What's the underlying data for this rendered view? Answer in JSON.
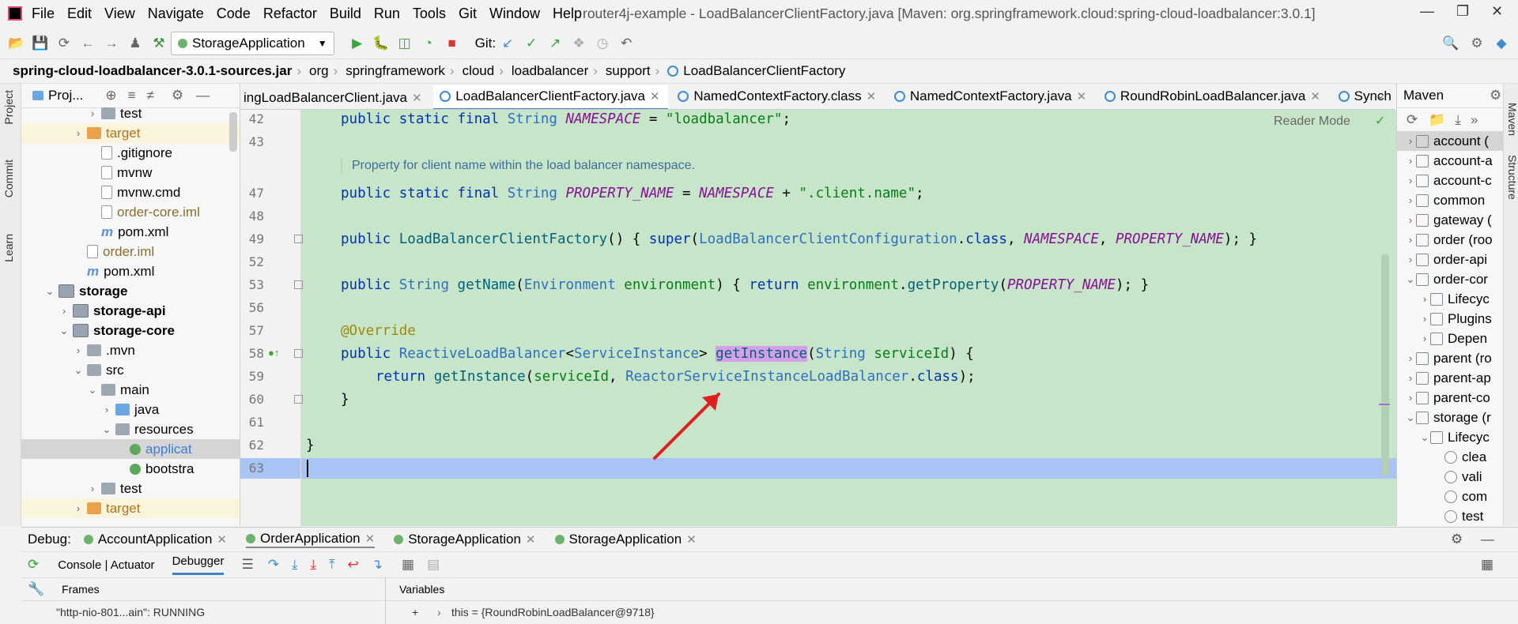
{
  "menu": [
    "File",
    "Edit",
    "View",
    "Navigate",
    "Code",
    "Refactor",
    "Build",
    "Run",
    "Tools",
    "Git",
    "Window",
    "Help"
  ],
  "window_title": "router4j-example - LoadBalancerClientFactory.java [Maven: org.springframework.cloud:spring-cloud-loadbalancer:3.0.1]",
  "toolbar": {
    "run_config": "StorageApplication",
    "git_label": "Git:"
  },
  "breadcrumb": [
    "spring-cloud-loadbalancer-3.0.1-sources.jar",
    "org",
    "springframework",
    "cloud",
    "loadbalancer",
    "support",
    "LoadBalancerClientFactory"
  ],
  "left_strip": [
    "Project",
    "Commit",
    "Learn"
  ],
  "project": {
    "title": "Proj...",
    "rows": [
      {
        "label": "test",
        "type": "folder"
      },
      {
        "label": "target",
        "type": "target"
      },
      {
        "label": ".gitignore",
        "type": "file"
      },
      {
        "label": "mvnw",
        "type": "file"
      },
      {
        "label": "mvnw.cmd",
        "type": "file"
      },
      {
        "label": "order-core.iml",
        "type": "file"
      },
      {
        "label": "pom.xml",
        "type": "maven"
      },
      {
        "label": "order.iml",
        "type": "file"
      },
      {
        "label": "pom.xml",
        "type": "maven"
      },
      {
        "label": "storage",
        "type": "module"
      },
      {
        "label": "storage-api",
        "type": "module"
      },
      {
        "label": "storage-core",
        "type": "module"
      },
      {
        "label": ".mvn",
        "type": "folder"
      },
      {
        "label": "src",
        "type": "folder"
      },
      {
        "label": "main",
        "type": "folder"
      },
      {
        "label": "java",
        "type": "source"
      },
      {
        "label": "resources",
        "type": "folder"
      },
      {
        "label": "applicat",
        "type": "spring"
      },
      {
        "label": "bootstra",
        "type": "spring"
      },
      {
        "label": "test",
        "type": "folder"
      },
      {
        "label": "target",
        "type": "target"
      }
    ]
  },
  "tabs": [
    {
      "label": "ingLoadBalancerClient.java",
      "active": false
    },
    {
      "label": "LoadBalancerClientFactory.java",
      "active": true
    },
    {
      "label": "NamedContextFactory.class",
      "active": false
    },
    {
      "label": "NamedContextFactory.java",
      "active": false
    },
    {
      "label": "RoundRobinLoadBalancer.java",
      "active": false
    },
    {
      "label": "Synch",
      "active": false
    }
  ],
  "editor": {
    "reader_mode": "Reader Mode",
    "doc_comment": "Property for client name within the load balancer namespace.",
    "line_numbers": [
      "42",
      "43",
      "47",
      "48",
      "49",
      "52",
      "53",
      "56",
      "57",
      "58",
      "59",
      "60",
      "61",
      "62",
      "63"
    ],
    "lines": {
      "l42": "public static final String NAMESPACE = \"loadbalancer\";",
      "l47": "public static final String PROPERTY_NAME = NAMESPACE + \".client.name\";",
      "l49": "public LoadBalancerClientFactory() { super(LoadBalancerClientConfiguration.class, NAMESPACE, PROPERTY_NAME); }",
      "l53": "public String getName(Environment environment) { return environment.getProperty(PROPERTY_NAME); }",
      "l57": "@Override",
      "l58": "public ReactiveLoadBalancer<ServiceInstance> getInstance(String serviceId) {",
      "l59": "return getInstance(serviceId, ReactorServiceInstanceLoadBalancer.class);",
      "l60": "}",
      "l62": "}"
    }
  },
  "maven": {
    "title": "Maven",
    "rows": [
      "account (",
      "account-a",
      "account-c",
      "common",
      "gateway (",
      "order (roo",
      "order-api",
      "order-cor",
      "Lifecyc",
      "Plugins",
      "Depen",
      "parent (ro",
      "parent-ap",
      "parent-co",
      "storage (r",
      "Lifecyc",
      "clea",
      "vali",
      "com",
      "test"
    ]
  },
  "right_strip": [
    "Maven",
    "Structure"
  ],
  "debug": {
    "label": "Debug:",
    "sessions": [
      "AccountApplication",
      "OrderApplication",
      "StorageApplication",
      "StorageApplication"
    ],
    "subtabs": [
      "Console | Actuator",
      "Debugger"
    ],
    "frames_label": "Frames",
    "variables_label": "Variables",
    "thread": "\"http-nio-801...ain\": RUNNING",
    "variable": "this = {RoundRobinLoadBalancer@9718}"
  },
  "colors": {
    "editor_bg": "#c7e5c9",
    "current_line": "#a8c4f4",
    "accent": "#4083c9",
    "arrow": "#e02020"
  }
}
